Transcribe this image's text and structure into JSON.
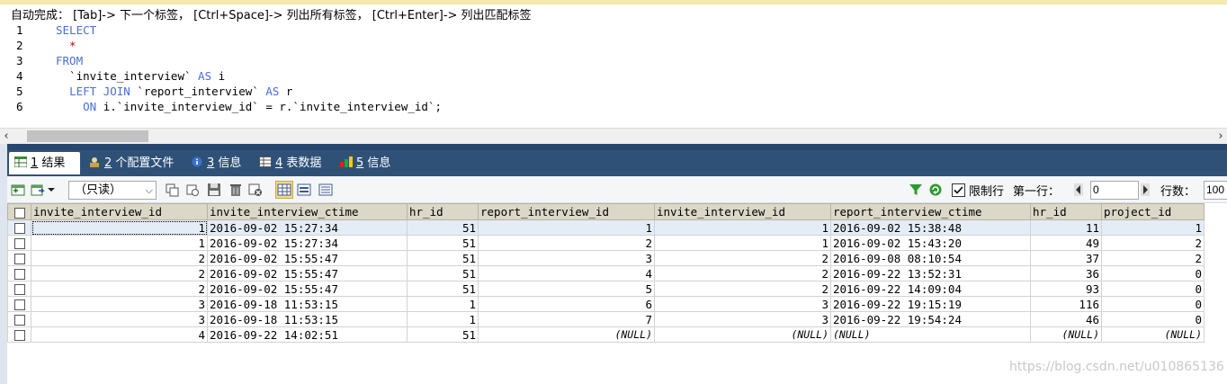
{
  "hint": "自动完成： [Tab]-> 下一个标签， [Ctrl+Space]-> 列出所有标签， [Ctrl+Enter]-> 列出匹配标签",
  "editor": {
    "lines": [
      {
        "n": "1",
        "parts": [
          {
            "t": "SELECT",
            "c": "kw"
          }
        ]
      },
      {
        "n": "2",
        "parts": [
          {
            "t": "  *",
            "c": "star"
          }
        ]
      },
      {
        "n": "3",
        "parts": [
          {
            "t": "FROM",
            "c": "kw"
          }
        ]
      },
      {
        "n": "4",
        "parts": [
          {
            "t": "  `invite_interview` ",
            "c": ""
          },
          {
            "t": "AS",
            "c": "kw"
          },
          {
            "t": " i",
            "c": ""
          }
        ]
      },
      {
        "n": "5",
        "parts": [
          {
            "t": "  ",
            "c": ""
          },
          {
            "t": "LEFT JOIN",
            "c": "kw"
          },
          {
            "t": " `report_interview` ",
            "c": ""
          },
          {
            "t": "AS",
            "c": "kw"
          },
          {
            "t": " r",
            "c": ""
          }
        ]
      },
      {
        "n": "6",
        "parts": [
          {
            "t": "    ",
            "c": ""
          },
          {
            "t": "ON",
            "c": "kw"
          },
          {
            "t": " i.`invite_interview_id` = r.`invite_interview_id`;",
            "c": ""
          }
        ]
      }
    ]
  },
  "tabs": [
    {
      "num": "1",
      "label": " 结果",
      "icon": "grid-icon",
      "active": true
    },
    {
      "num": "2",
      "label": " 个配置文件",
      "icon": "profile-icon",
      "active": false
    },
    {
      "num": "3",
      "label": " 信息",
      "icon": "info-icon",
      "active": false
    },
    {
      "num": "4",
      "label": " 表数据",
      "icon": "table-icon",
      "active": false
    },
    {
      "num": "5",
      "label": " 信息",
      "icon": "info-color-icon",
      "active": false
    }
  ],
  "toolbar": {
    "readonly_label": "（只读）",
    "limit_label": "限制行",
    "first_row_label": "第一行：",
    "first_row_value": "0",
    "rows_label": "行数：",
    "rows_value": "100"
  },
  "grid": {
    "columns": [
      "invite_interview_id",
      "invite_interview_ctime",
      "hr_id",
      "report_interview_id",
      "invite_interview_id",
      "report_interview_ctime",
      "hr_id",
      "project_id"
    ],
    "rows": [
      [
        "1",
        "2016-09-02 15:27:34",
        "51",
        "1",
        "1",
        "2016-09-02 15:38:48",
        "11",
        "1"
      ],
      [
        "1",
        "2016-09-02 15:27:34",
        "51",
        "2",
        "1",
        "2016-09-02 15:43:20",
        "49",
        "2"
      ],
      [
        "2",
        "2016-09-02 15:55:47",
        "51",
        "3",
        "2",
        "2016-09-08 08:10:54",
        "37",
        "2"
      ],
      [
        "2",
        "2016-09-02 15:55:47",
        "51",
        "4",
        "2",
        "2016-09-22 13:52:31",
        "36",
        "0"
      ],
      [
        "2",
        "2016-09-02 15:55:47",
        "51",
        "5",
        "2",
        "2016-09-22 14:09:04",
        "93",
        "0"
      ],
      [
        "3",
        "2016-09-18 11:53:15",
        "1",
        "6",
        "3",
        "2016-09-22 19:15:19",
        "116",
        "0"
      ],
      [
        "3",
        "2016-09-18 11:53:15",
        "1",
        "7",
        "3",
        "2016-09-22 19:54:24",
        "46",
        "0"
      ],
      [
        "4",
        "2016-09-22 14:02:51",
        "51",
        "(NULL)",
        "(NULL)",
        "(NULL)",
        "(NULL)",
        "(NULL)"
      ]
    ]
  },
  "watermark": "https://blog.csdn.net/u010865136"
}
